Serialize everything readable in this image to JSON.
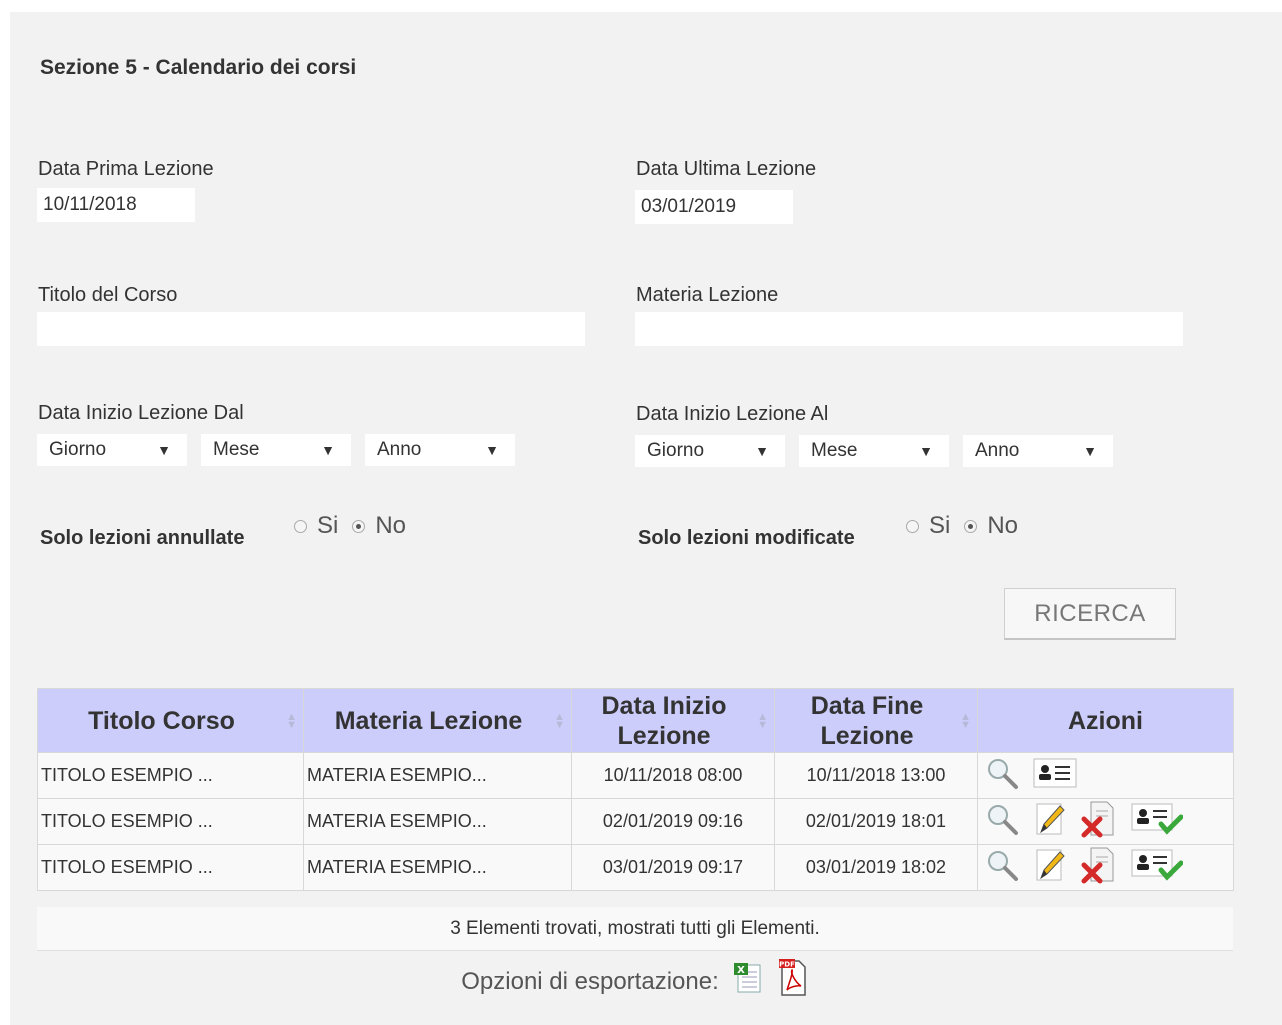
{
  "section": {
    "title": "Sezione 5 - Calendario dei corsi"
  },
  "filters": {
    "data_prima_label": "Data Prima Lezione",
    "data_prima_value": "10/11/2018",
    "data_ultima_label": "Data Ultima Lezione",
    "data_ultima_value": "03/01/2019",
    "titolo_label": "Titolo del Corso",
    "titolo_value": "",
    "materia_label": "Materia Lezione",
    "materia_value": "",
    "inizio_dal_label": "Data Inizio Lezione Dal",
    "inizio_al_label": "Data Inizio Lezione Al",
    "giorno": "Giorno",
    "mese": "Mese",
    "anno": "Anno",
    "annullate_label": "Solo lezioni annullate",
    "modificate_label": "Solo lezioni modificate",
    "si": "Si",
    "no": "No",
    "annullate_selected": "No",
    "modificate_selected": "No"
  },
  "search_button": "RICERCA",
  "table": {
    "headers": [
      "Titolo Corso",
      "Materia Lezione",
      "Data Inizio Lezione",
      "Data Fine Lezione",
      "Azioni"
    ],
    "rows": [
      {
        "titolo": "TITOLO ESEMPIO ...",
        "materia": "MATERIA ESEMPIO...",
        "inizio": "10/11/2018 08:00",
        "fine": "10/11/2018 13:00",
        "actions": [
          "magnifier-icon",
          "contact-card-icon"
        ]
      },
      {
        "titolo": "TITOLO ESEMPIO ...",
        "materia": "MATERIA ESEMPIO...",
        "inizio": "02/01/2019 09:16",
        "fine": "02/01/2019 18:01",
        "actions": [
          "magnifier-icon",
          "pencil-icon",
          "delete-document-icon",
          "contact-check-icon"
        ]
      },
      {
        "titolo": "TITOLO ESEMPIO ...",
        "materia": "MATERIA ESEMPIO...",
        "inizio": "03/01/2019 09:17",
        "fine": "03/01/2019 18:02",
        "actions": [
          "magnifier-icon",
          "pencil-icon",
          "delete-document-icon",
          "contact-check-icon"
        ]
      }
    ]
  },
  "summary": "3 Elementi trovati, mostrati tutti gli Elementi.",
  "export": {
    "label": "Opzioni di esportazione:",
    "icons": [
      "excel-icon",
      "pdf-icon"
    ]
  },
  "colors": {
    "panel_bg": "#f2f2f2",
    "table_header_bg": "#cccdfb",
    "row_bg": "#f9f9f9"
  }
}
